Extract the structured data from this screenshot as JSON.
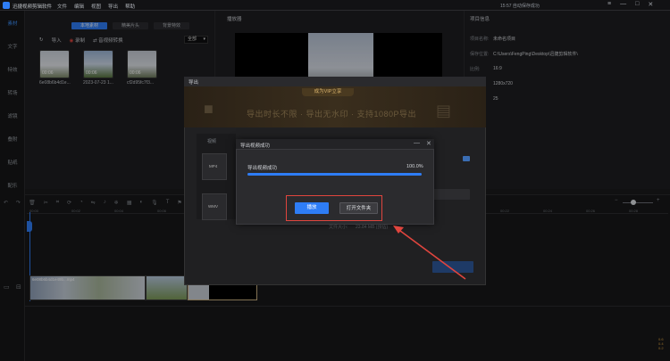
{
  "app": {
    "title": "迅捷视频剪辑软件",
    "menu": [
      "文件",
      "编辑",
      "视图",
      "导出",
      "帮助"
    ],
    "status": "15:57 自动保存成功",
    "window_buttons": [
      "≡",
      "—",
      "□",
      "✕"
    ]
  },
  "sidebar": {
    "items": [
      "素材",
      "文字",
      "特效",
      "转场",
      "滤镜",
      "叠附",
      "贴纸",
      "配乐"
    ]
  },
  "media": {
    "tabs": [
      "本地素材",
      "精美片头",
      "背景特效"
    ],
    "toolbar": {
      "import": "导入",
      "record": "录制",
      "record_convert": "音视频转换"
    },
    "filter": "全部",
    "items": [
      {
        "label": "6e08b6b4d1e...",
        "duration": "00:06"
      },
      {
        "label": "2023-07-23 1...",
        "duration": "00:06"
      },
      {
        "label": "cf2d95fc7f3...",
        "duration": "00:06"
      }
    ]
  },
  "player": {
    "title": "播放器"
  },
  "project": {
    "title": "项目信息",
    "rows": [
      {
        "key": "项目名称:",
        "value": "未命名项目"
      },
      {
        "key": "保存位置:",
        "value": "C:\\Users\\FengPing\\Desktop\\迅捷剪辑软件\\"
      },
      {
        "key": "比例:",
        "value": "16:9"
      },
      {
        "key": "分辨率:",
        "value": "1280x720"
      },
      {
        "key": "帧率:",
        "value": "25"
      }
    ]
  },
  "timeline": {
    "ruler_labels": [
      "00:00",
      "00:02",
      "00:04",
      "00:06",
      "00:08",
      "00:10",
      "00:12",
      "00:14",
      "00:16",
      "00:18",
      "00:20",
      "00:22",
      "00:24",
      "00:26",
      "00:28"
    ],
    "clip_label": "6e08b6b4d1e49b...mp4",
    "meter": [
      "0.6",
      "0.4",
      "0.2"
    ]
  },
  "export_dialog": {
    "title": "导出",
    "vip_tag": "成为VIP立享",
    "vip_text": "导出时长不限 · 导出无水印 · 支持1080P导出",
    "format_header": "视频",
    "format_tiles": [
      "MP4",
      "WMV"
    ],
    "file_size_label": "文件大小:",
    "file_size_value": "23.84 MB (预估)"
  },
  "success_dialog": {
    "title": "导出视频成功",
    "progress_label": "导出视频成功",
    "progress_pct": "100.0%",
    "progress": 1.0,
    "play_button": "播放",
    "open_folder_button": "打开文件夹"
  },
  "colors": {
    "accent": "#2e7df6",
    "highlight": "#e0453e"
  }
}
